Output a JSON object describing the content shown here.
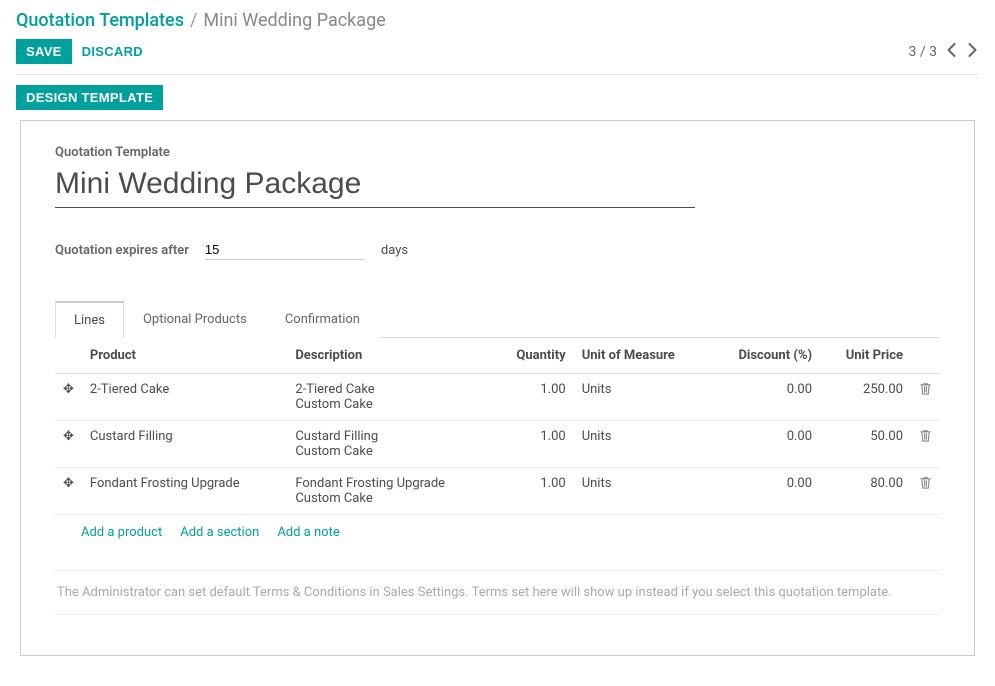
{
  "breadcrumb": {
    "parent": "Quotation Templates",
    "sep": "/",
    "current": "Mini Wedding Package"
  },
  "toolbar": {
    "save_label": "Save",
    "discard_label": "Discard",
    "pager_text": "3 / 3"
  },
  "statusbar": {
    "design_template_label": "Design Template"
  },
  "form": {
    "template_label": "Quotation Template",
    "template_value": "Mini Wedding Package",
    "expire_label": "Quotation expires after",
    "expire_value": "15",
    "expire_unit": "days"
  },
  "tabs": {
    "lines": "Lines",
    "optional": "Optional Products",
    "confirmation": "Confirmation"
  },
  "columns": {
    "product": "Product",
    "description": "Description",
    "quantity": "Quantity",
    "uom": "Unit of Measure",
    "discount": "Discount (%)",
    "unit_price": "Unit Price"
  },
  "lines": [
    {
      "product": "2-Tiered Cake",
      "desc_line1": "2-Tiered Cake",
      "desc_line2": "Custom Cake",
      "qty": "1.00",
      "uom": "Units",
      "discount": "0.00",
      "price": "250.00"
    },
    {
      "product": "Custard Filling",
      "desc_line1": "Custard Filling",
      "desc_line2": "Custom Cake",
      "qty": "1.00",
      "uom": "Units",
      "discount": "0.00",
      "price": "50.00"
    },
    {
      "product": "Fondant Frosting Upgrade",
      "desc_line1": "Fondant Frosting Upgrade",
      "desc_line2": "Custom Cake",
      "qty": "1.00",
      "uom": "Units",
      "discount": "0.00",
      "price": "80.00"
    }
  ],
  "add": {
    "product": "Add a product",
    "section": "Add a section",
    "note": "Add a note"
  },
  "terms_placeholder": "The Administrator can set default Terms & Conditions in Sales Settings. Terms set here will show up instead if you select this quotation template."
}
